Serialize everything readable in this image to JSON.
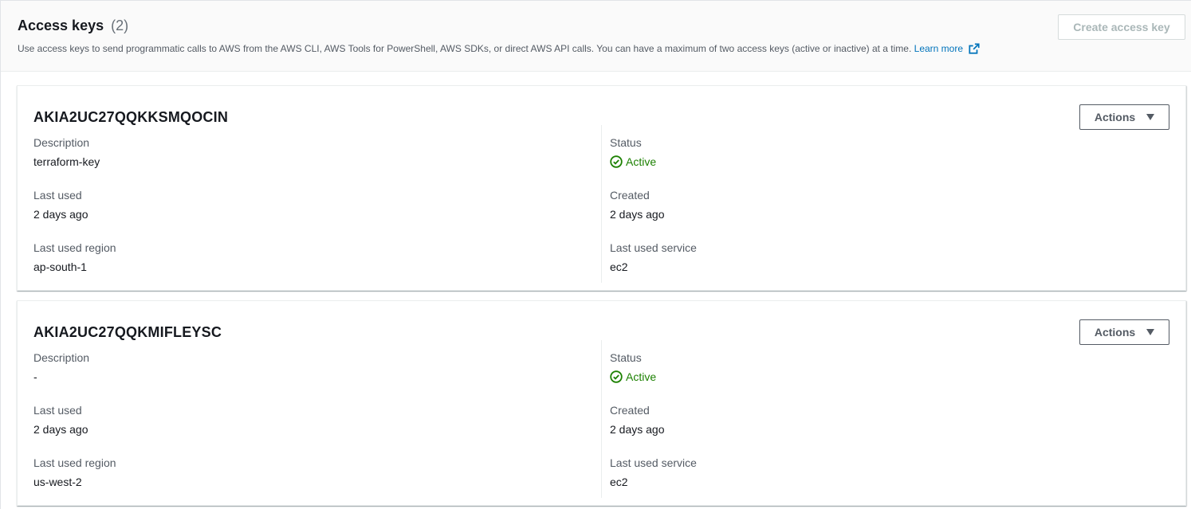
{
  "header": {
    "title": "Access keys",
    "count": "(2)",
    "description": "Use access keys to send programmatic calls to AWS from the AWS CLI, AWS Tools for PowerShell, AWS SDKs, or direct AWS API calls. You can have a maximum of two access keys (active or inactive) at a time.",
    "learn_more": "Learn more",
    "create_button": "Create access key"
  },
  "labels": {
    "description": "Description",
    "last_used": "Last used",
    "last_used_region": "Last used region",
    "status": "Status",
    "created": "Created",
    "last_used_service": "Last used service",
    "actions": "Actions"
  },
  "keys": [
    {
      "id": "AKIA2UC27QQKKSMQOCIN",
      "description": "terraform-key",
      "last_used": "2 days ago",
      "last_used_region": "ap-south-1",
      "status": "Active",
      "created": "2 days ago",
      "last_used_service": "ec2"
    },
    {
      "id": "AKIA2UC27QQKMIFLEYSC",
      "description": "-",
      "last_used": "2 days ago",
      "last_used_region": "us-west-2",
      "status": "Active",
      "created": "2 days ago",
      "last_used_service": "ec2"
    }
  ],
  "colors": {
    "link": "#0073bb",
    "active": "#1d8102",
    "disabled_button_text": "#aab7b8"
  },
  "icons": {
    "external_link": "external-link-icon",
    "status_active": "check-circle-icon",
    "dropdown": "caret-down-icon"
  }
}
